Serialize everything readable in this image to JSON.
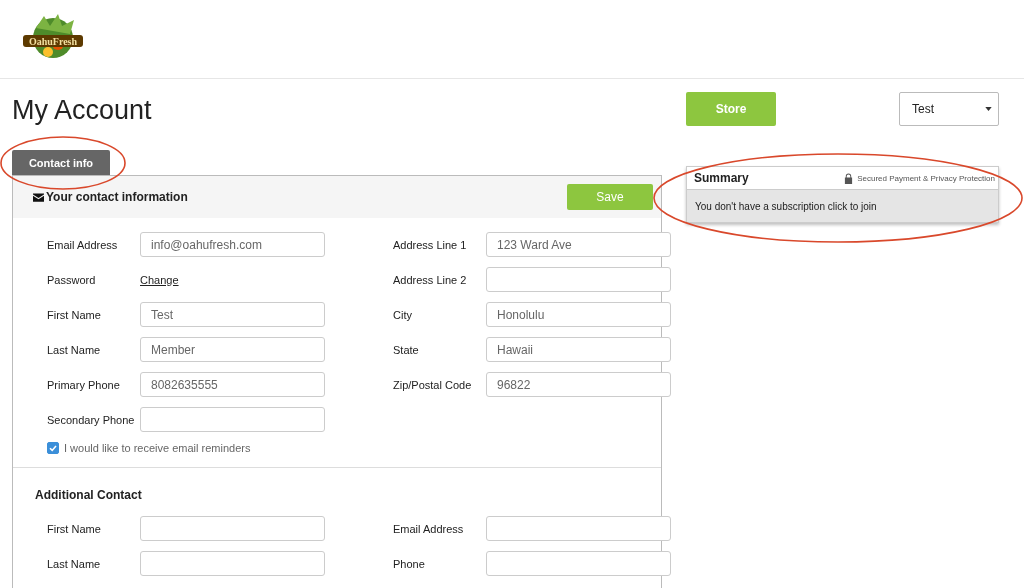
{
  "logo": {
    "text": "OahuFresh"
  },
  "page_title": "My Account",
  "store_button": "Store",
  "account_select": {
    "value": "Test"
  },
  "tabs": [
    {
      "label": "Contact info",
      "selected": true
    }
  ],
  "contact_panel": {
    "title": "Your contact information",
    "save_button": "Save",
    "left_fields": [
      {
        "label": "Email Address",
        "kind": "input",
        "value": "info@oahufresh.com"
      },
      {
        "label": "Password",
        "kind": "link",
        "value": "Change"
      },
      {
        "label": "First Name",
        "kind": "input",
        "value": "Test"
      },
      {
        "label": "Last Name",
        "kind": "input",
        "value": "Member"
      },
      {
        "label": "Primary Phone",
        "kind": "input",
        "value": "8082635555"
      },
      {
        "label": "Secondary Phone",
        "kind": "input"
      }
    ],
    "right_fields": [
      {
        "label": "Address Line 1",
        "kind": "input",
        "value": "123 Ward Ave"
      },
      {
        "label": "Address Line 2",
        "kind": "input"
      },
      {
        "label": "City",
        "kind": "input",
        "value": "Honolulu"
      },
      {
        "label": "State",
        "kind": "input",
        "value": "Hawaii"
      },
      {
        "label": "Zip/Postal Code",
        "kind": "input",
        "value": "96822"
      }
    ],
    "email_reminders": {
      "label": "I would like to receive email reminders",
      "checked": true
    }
  },
  "additional_contact": {
    "title": "Additional Contact",
    "left_fields": [
      {
        "label": "First Name",
        "kind": "input"
      },
      {
        "label": "Last Name",
        "kind": "input"
      }
    ],
    "right_fields": [
      {
        "label": "Email Address",
        "kind": "input"
      },
      {
        "label": "Phone",
        "kind": "input"
      }
    ]
  },
  "summary": {
    "title": "Summary",
    "security_note": "Secured Payment & Privacy Protection",
    "message": "You don't have a subscription click to join"
  }
}
